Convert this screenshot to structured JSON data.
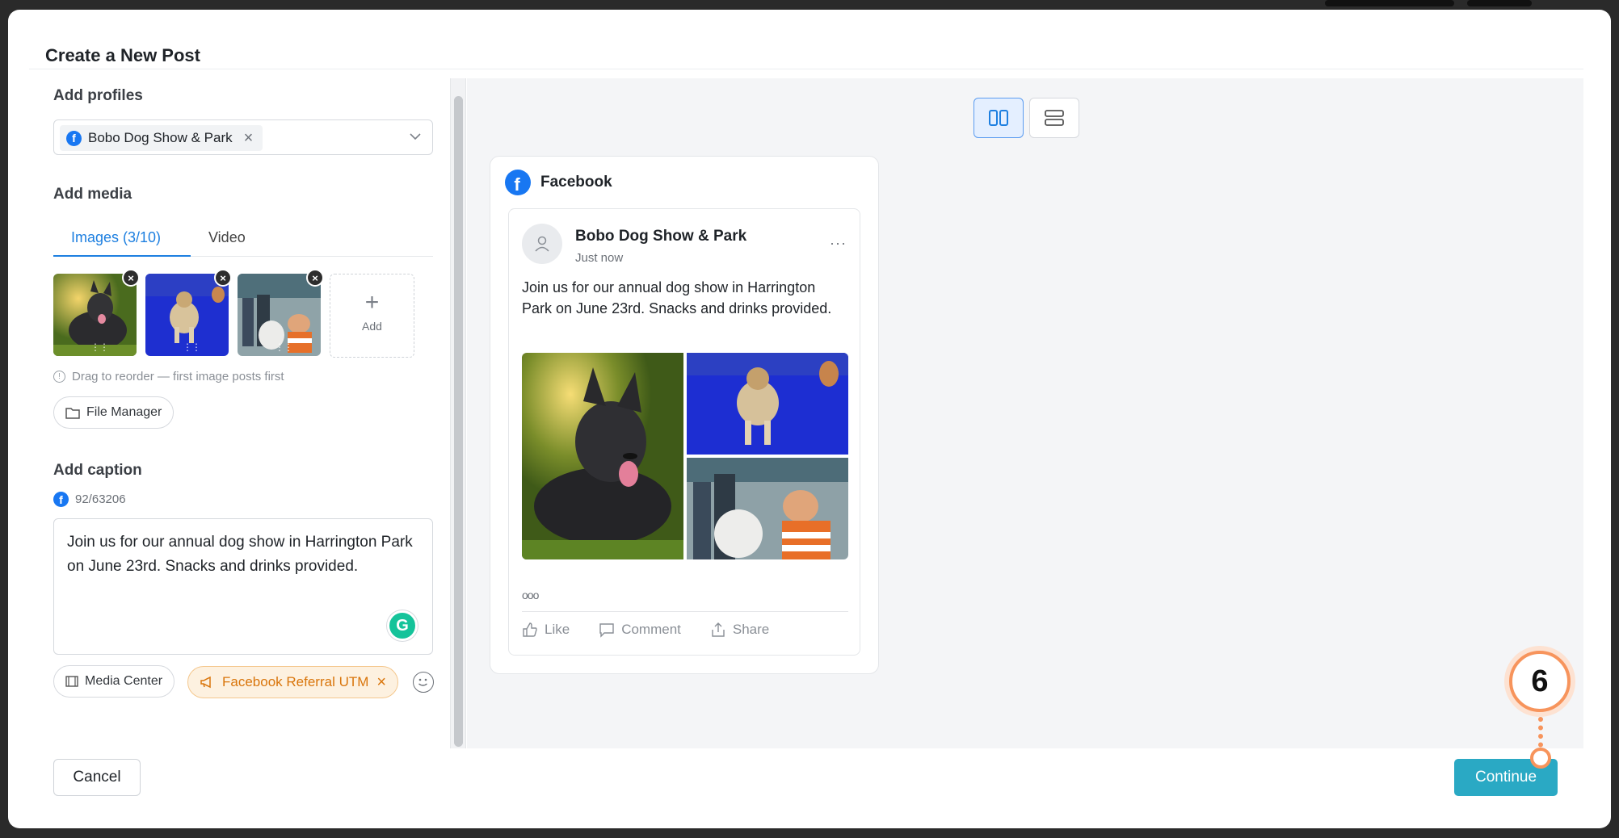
{
  "modal": {
    "title": "Create a New Post"
  },
  "profiles": {
    "label": "Add profiles",
    "selected": "Bobo Dog Show & Park"
  },
  "media": {
    "label": "Add media",
    "tabs": [
      {
        "label": "Images (3/10)",
        "active": true
      },
      {
        "label": "Video",
        "active": false
      }
    ],
    "add_label": "Add",
    "hint": "Drag to reorder — first image posts first",
    "file_manager": "File Manager"
  },
  "caption": {
    "label": "Add caption",
    "count": "92/63206",
    "text": "Join us for our annual dog show in Harrington Park on June 23rd. Snacks and drinks provided.",
    "media_center": "Media Center",
    "utm": "Facebook Referral UTM"
  },
  "preview": {
    "network": "Facebook",
    "post_name": "Bobo Dog Show & Park",
    "post_time": "Just now",
    "post_text": "Join us for our annual dog show in Harrington Park on June 23rd. Snacks and drinks provided.",
    "reactions": "ooo",
    "actions": {
      "like": "Like",
      "comment": "Comment",
      "share": "Share"
    }
  },
  "footer": {
    "cancel": "Cancel",
    "continue": "Continue"
  },
  "step_badge": "6",
  "colors": {
    "accent": "#1d7fe0",
    "continue": "#2aa9c4",
    "facebook": "#1877f2",
    "utm": "#d9750b",
    "step": "#f7945c"
  }
}
